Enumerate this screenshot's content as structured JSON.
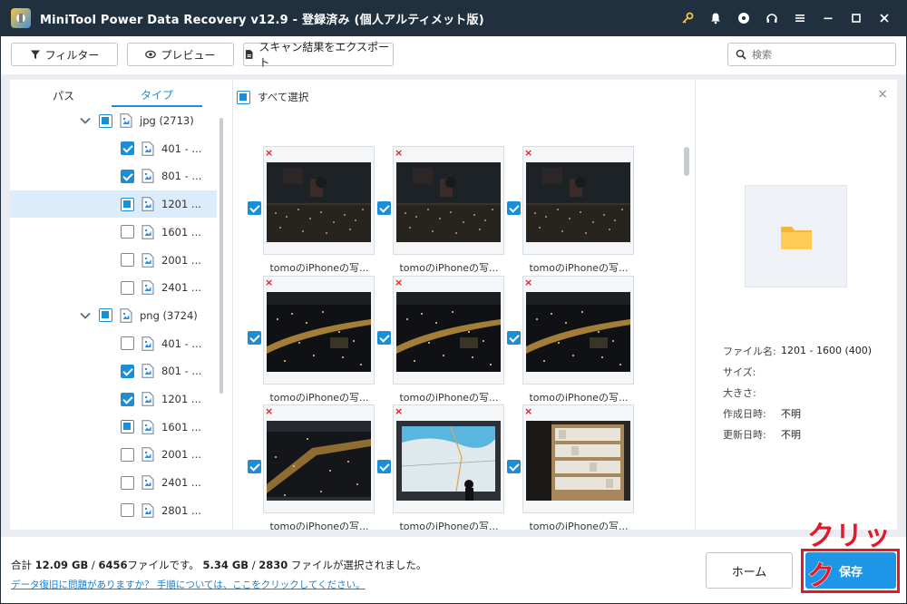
{
  "window": {
    "title": "MiniTool Power Data Recovery v12.9 - 登録済み (個人アルティメット版)",
    "icons": [
      "key-icon",
      "bell-icon",
      "disc-icon",
      "headset-icon",
      "menu-icon",
      "minimize-icon",
      "maximize-icon",
      "close-icon"
    ]
  },
  "toolbar": {
    "filter_label": "フィルター",
    "preview_label": "プレビュー",
    "export_label": "スキャン結果をエクスポート",
    "search_placeholder": "検索"
  },
  "tabs": [
    {
      "label": "パス",
      "active": false
    },
    {
      "label": "タイプ",
      "active": true
    }
  ],
  "tree": [
    {
      "label": "jpg (2713)",
      "state": "partial",
      "level": 0,
      "expanded": true
    },
    {
      "label": "401 - ...",
      "state": "checked",
      "level": 1
    },
    {
      "label": "801 - ...",
      "state": "checked",
      "level": 1
    },
    {
      "label": "1201 ...",
      "state": "partial",
      "level": 1,
      "selected": true
    },
    {
      "label": "1601 ...",
      "state": "unchecked",
      "level": 1
    },
    {
      "label": "2001 ...",
      "state": "unchecked",
      "level": 1
    },
    {
      "label": "2401 ...",
      "state": "unchecked",
      "level": 1
    },
    {
      "label": "png (3724)",
      "state": "partial",
      "level": 0,
      "expanded": true
    },
    {
      "label": "401 - ...",
      "state": "unchecked",
      "level": 1
    },
    {
      "label": "801 - ...",
      "state": "checked",
      "level": 1
    },
    {
      "label": "1201 ...",
      "state": "checked",
      "level": 1
    },
    {
      "label": "1601 ...",
      "state": "partial",
      "level": 1
    },
    {
      "label": "2001 ...",
      "state": "unchecked",
      "level": 1
    },
    {
      "label": "2401 ...",
      "state": "unchecked",
      "level": 1
    },
    {
      "label": "2801 ...",
      "state": "unchecked",
      "level": 1
    }
  ],
  "grid": {
    "select_all_label": "すべて選択",
    "items": [
      {
        "caption": "tomoのiPhoneの写...",
        "checked": true,
        "scene": "night-window"
      },
      {
        "caption": "tomoのiPhoneの写...",
        "checked": true,
        "scene": "night-window"
      },
      {
        "caption": "tomoのiPhoneの写...",
        "checked": true,
        "scene": "night-window"
      },
      {
        "caption": "tomoのiPhoneの写...",
        "checked": true,
        "scene": "night-city"
      },
      {
        "caption": "tomoのiPhoneの写...",
        "checked": true,
        "scene": "night-city"
      },
      {
        "caption": "tomoのiPhoneの写...",
        "checked": true,
        "scene": "night-city"
      },
      {
        "caption": "tomoのiPhoneの写...",
        "checked": true,
        "scene": "night-aerial"
      },
      {
        "caption": "tomoのiPhoneの写...",
        "checked": true,
        "scene": "map-board"
      },
      {
        "caption": "tomoのiPhoneの写...",
        "checked": true,
        "scene": "shelves"
      }
    ]
  },
  "preview": {
    "close_label": "×",
    "fields": [
      {
        "label": "ファイル名:",
        "value": "1201 - 1600 (400)"
      },
      {
        "label": "サイズ:",
        "value": ""
      },
      {
        "label": "大きさ:",
        "value": ""
      },
      {
        "label": "作成日時:",
        "value": "不明"
      },
      {
        "label": "更新日時:",
        "value": "不明"
      }
    ]
  },
  "footer": {
    "total_prefix": "合計 ",
    "total_size": "12.09 GB",
    "total_sep": " / ",
    "total_files": "6456",
    "total_suffix": "ファイルです。 ",
    "sel_size": "5.34 GB",
    "sel_sep": " / ",
    "sel_files": "2830",
    "sel_suffix": " ファイルが選択されました。",
    "help_link": "データ復旧に問題がありますか？ 手順については、ここをクリックしてください。",
    "home_label": "ホーム",
    "save_label": "保存"
  },
  "annotation": {
    "text": "クリック",
    "color": "#e0192b"
  },
  "colors": {
    "titlebar": "#20303f",
    "accent": "#1a8fd8",
    "save_button": "#1e96e8"
  }
}
